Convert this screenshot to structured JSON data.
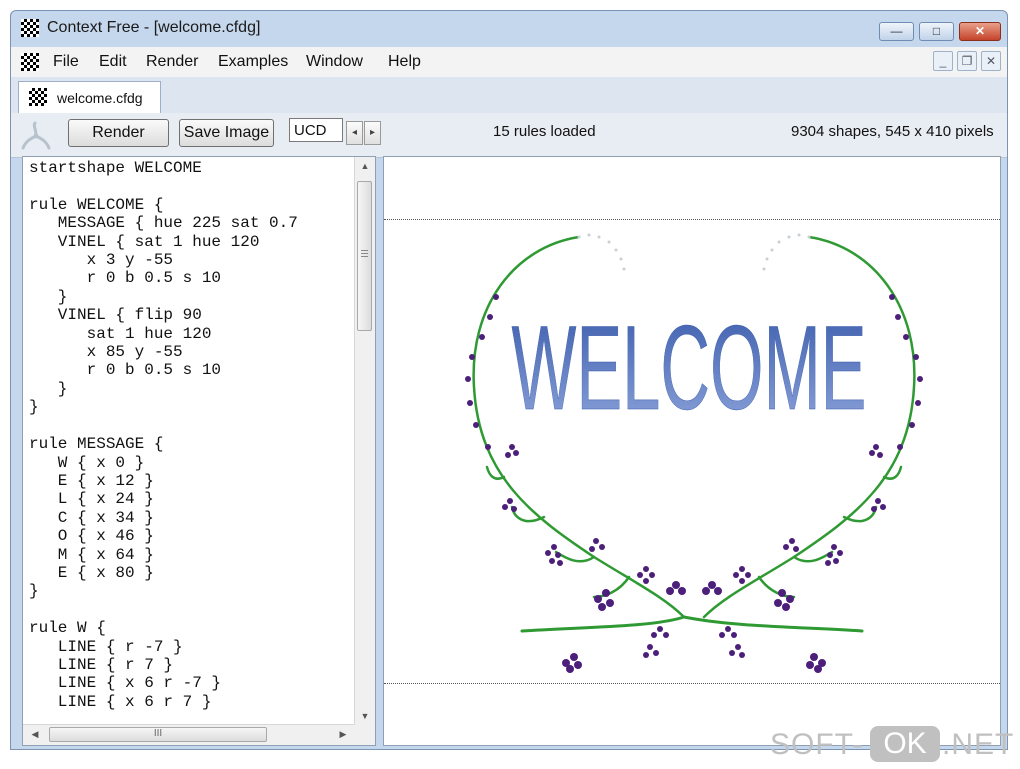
{
  "window": {
    "title": "Context Free - [welcome.cfdg]",
    "minimize_glyph": "—",
    "maximize_glyph": "□",
    "close_glyph": "✕"
  },
  "menu": {
    "items": [
      "File",
      "Edit",
      "Render",
      "Examples",
      "Window",
      "Help"
    ],
    "mdi_minimize": "_",
    "mdi_restore": "❐",
    "mdi_close": "✕"
  },
  "tab": {
    "label": "welcome.cfdg"
  },
  "toolbar": {
    "render_label": "Render",
    "save_label": "Save Image",
    "variation_value": "UCD",
    "prev_glyph": "◂",
    "next_glyph": "▸",
    "rules_status": "15 rules loaded",
    "shapes_status": "9304 shapes, 545 x 410 pixels"
  },
  "editor": {
    "code": "startshape WELCOME\n\nrule WELCOME {\n   MESSAGE { hue 225 sat 0.7\n   VINEL { sat 1 hue 120\n      x 3 y -55\n      r 0 b 0.5 s 10\n   }\n   VINEL { flip 90\n      sat 1 hue 120\n      x 85 y -55\n      r 0 b 0.5 s 10\n   }\n}\n\nrule MESSAGE {\n   W { x 0 }\n   E { x 12 }\n   L { x 24 }\n   C { x 34 }\n   O { x 46 }\n   M { x 64 }\n   E { x 80 }\n}\n\nrule W {\n   LINE { r -7 }\n   LINE { r 7 }\n   LINE { x 6 r -7 }\n   LINE { x 6 r 7 }",
    "scroll_up": "▲",
    "scroll_down": "▼",
    "scroll_left": "◀",
    "scroll_right": "▶",
    "hthumb_grip": "III"
  },
  "canvas": {
    "welcome_text": "WELCOME",
    "text_color": "#3a5bab",
    "vine_color": "#2f9a33",
    "berry_color": "#4b1f7a"
  },
  "watermark": {
    "left": "SOFT-",
    "pill": "OK",
    "right": ".NET"
  }
}
